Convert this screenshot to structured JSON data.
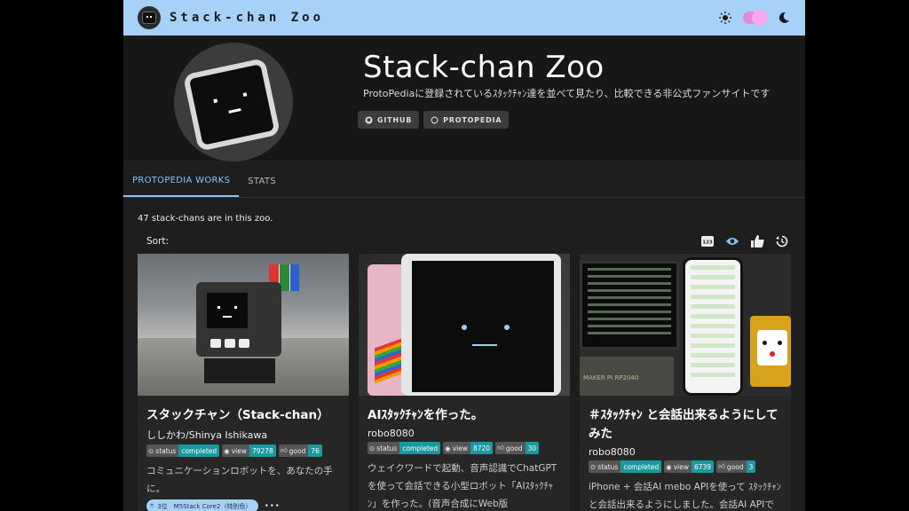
{
  "header": {
    "brand": "Stack-chan Zoo",
    "icons": {
      "logo": "stack-chan-logo-icon",
      "theme_light": "sun-icon",
      "theme_toggle": "toggle-switch",
      "theme_dark": "moon-icon"
    }
  },
  "hero": {
    "title": "Stack-chan Zoo",
    "description": "ProtoPediaに登録されているｽﾀｯｸﾁｬﾝ達を並べて見たり、比較できる非公式ファンサイトです",
    "buttons": [
      {
        "label": "GITHUB",
        "icon": "github-icon"
      },
      {
        "label": "PROTOPEDIA",
        "icon": "protopedia-icon"
      }
    ]
  },
  "tabs": [
    {
      "label": "PROTOPEDIA WORKS",
      "active": true
    },
    {
      "label": "STATS",
      "active": false
    }
  ],
  "summary": {
    "count_text": "47 stack-chans are in this zoo."
  },
  "sort": {
    "label": "Sort:",
    "options": [
      {
        "icon": "numeric-sort-icon",
        "text": "123"
      },
      {
        "icon": "eye-icon"
      },
      {
        "icon": "thumbs-up-icon"
      },
      {
        "icon": "history-icon"
      }
    ]
  },
  "cards": [
    {
      "title": "スタックチャン（Stack-chan）",
      "author": "ししかわ/Shinya Ishikawa",
      "status_key": "status",
      "status": "completed",
      "view_key": "view",
      "views": "79278",
      "good_key": "good",
      "goods": "76",
      "description": "コミュニケーションロボットを、あなたの手に。",
      "chip": "3位　M5Stack Core2（特別色）",
      "more": "•••"
    },
    {
      "title": "AIｽﾀｯｸﾁｬﾝを作った。",
      "author": "robo8080",
      "status_key": "status",
      "status": "completed",
      "view_key": "view",
      "views": "8720",
      "good_key": "good",
      "goods": "30",
      "description": "ウェイクワードで起動、音声認識でChatGPTを使って会話できる小型ロボット「AIｽﾀｯｸﾁｬﾝ」を作った。(音声合成にWeb版"
    },
    {
      "title": "＃ｽﾀｯｸﾁｬﾝ と会話出来るようにしてみた",
      "author": "robo8080",
      "status_key": "status",
      "status": "completed",
      "view_key": "view",
      "views": "6739",
      "good_key": "good",
      "goods": "3",
      "description": "iPhone + 会話AI mebo APIを使って ｽﾀｯｸﾁｬﾝと会話出来るようにしました。会話AI APIで",
      "thumb_text": "MAKER PI RP2040"
    }
  ],
  "colors": {
    "topbar": "#a6d2f7",
    "accent": "#8ac4f5",
    "badge": "#1a9aa0",
    "toggle": "#e58ad8"
  }
}
